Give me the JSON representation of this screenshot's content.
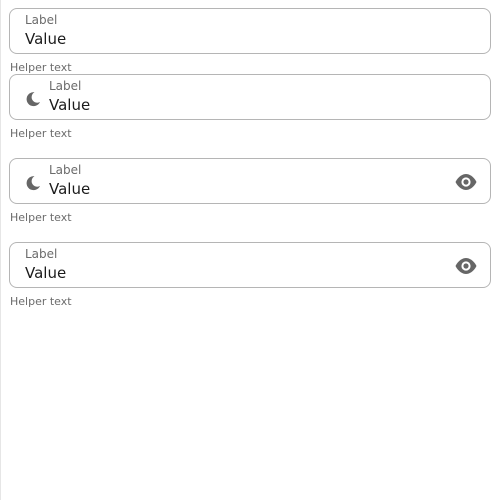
{
  "fields": [
    {
      "label": "Label",
      "value": "Value",
      "helper": "Helper text",
      "leading_icon": null,
      "trailing_icon": null
    },
    {
      "label": "Label",
      "value": "Value",
      "helper": "Helper text",
      "leading_icon": "moon-icon",
      "trailing_icon": null
    },
    {
      "label": "Label",
      "value": "Value",
      "helper": "Helper text",
      "leading_icon": "moon-icon",
      "trailing_icon": "eye-icon"
    },
    {
      "label": "Label",
      "value": "Value",
      "helper": "Helper text",
      "leading_icon": null,
      "trailing_icon": "eye-icon"
    }
  ],
  "colors": {
    "outline": "#b5b5b5",
    "label": "#6b6b6b",
    "value": "#1b1b1b",
    "icon": "#666666"
  }
}
